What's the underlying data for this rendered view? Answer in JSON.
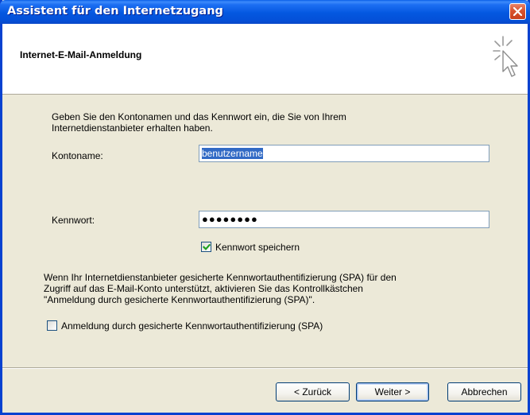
{
  "window": {
    "title": "Assistent für den Internetzugang"
  },
  "header": {
    "title": "Internet-E-Mail-Anmeldung",
    "icon": "wizard-cursor-icon"
  },
  "form": {
    "intro_line1": "Geben Sie den Kontonamen und das Kennwort ein, die Sie von Ihrem",
    "intro_line2": "Internetdienstanbieter erhalten haben.",
    "account_label": "Kontoname:",
    "account_value": "benutzername",
    "password_label": "Kennwort:",
    "password_value": "●●●●●●●●",
    "save_password_label": "Kennwort speichern",
    "save_password_checked": true,
    "spa_line1": "Wenn Ihr Internetdienstanbieter gesicherte Kennwortauthentifizierung (SPA) für den",
    "spa_line2": "Zugriff auf das E-Mail-Konto unterstützt, aktivieren Sie das Kontrollkästchen",
    "spa_line3": "\"Anmeldung durch gesicherte Kennwortauthentifizierung (SPA)\".",
    "spa_checkbox_label": "Anmeldung durch gesicherte Kennwortauthentifizierung (SPA)",
    "spa_checked": false
  },
  "buttons": {
    "back": "< Zurück",
    "next": "Weiter >",
    "cancel": "Abbrechen"
  },
  "colors": {
    "titlebar": "#0458E0",
    "face": "#ECE9D8",
    "selection": "#316AC5",
    "check": "#21A121"
  }
}
